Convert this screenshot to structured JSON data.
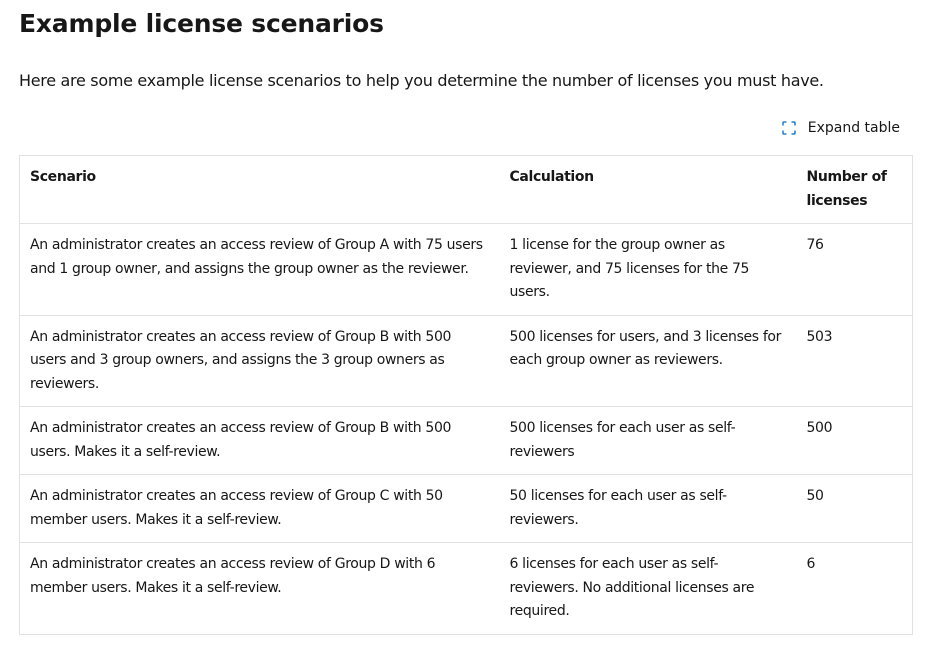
{
  "heading": "Example license scenarios",
  "intro": "Here are some example license scenarios to help you determine the number of licenses you must have.",
  "expand": {
    "label": "Expand table",
    "icon": "expand-icon"
  },
  "table": {
    "headers": {
      "scenario": "Scenario",
      "calculation": "Calculation",
      "licenses": "Number of licenses"
    },
    "rows": [
      {
        "scenario": "An administrator creates an access review of Group A with 75 users and 1 group owner, and assigns the group owner as the reviewer.",
        "calculation": "1 license for the group owner as reviewer, and 75 licenses for the 75 users.",
        "licenses": "76"
      },
      {
        "scenario": "An administrator creates an access review of Group B with 500 users and 3 group owners, and assigns the 3 group owners as reviewers.",
        "calculation": "500 licenses for users, and 3 licenses for each group owner as reviewers.",
        "licenses": "503"
      },
      {
        "scenario": "An administrator creates an access review of Group B with 500 users. Makes it a self-review.",
        "calculation": "500 licenses for each user as self-reviewers",
        "licenses": "500"
      },
      {
        "scenario": "An administrator creates an access review of Group C with 50 member users. Makes it a self-review.",
        "calculation": "50 licenses for each user as self-reviewers.",
        "licenses": "50"
      },
      {
        "scenario": "An administrator creates an access review of Group D with 6 member users. Makes it a self-review.",
        "calculation": "6 licenses for each user as self-reviewers. No additional licenses are required.",
        "licenses": "6"
      }
    ]
  },
  "colors": {
    "text": "#171717",
    "border": "#e1e1e1",
    "icon_accent": "#0067b8"
  }
}
